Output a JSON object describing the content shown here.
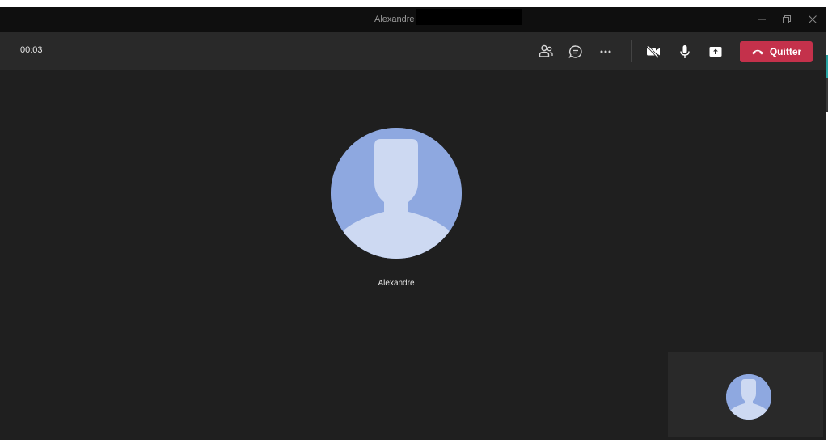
{
  "window": {
    "title": "Alexandre"
  },
  "toolbar": {
    "timer": "00:03",
    "leave_label": "Quitter",
    "buttons": [
      {
        "icon": "participants-icon"
      },
      {
        "icon": "chat-icon"
      },
      {
        "icon": "more-options-icon"
      },
      {
        "icon": "camera-off-icon"
      },
      {
        "icon": "microphone-icon"
      },
      {
        "icon": "share-screen-icon"
      }
    ]
  },
  "stage": {
    "participant_name": "Alexandre"
  },
  "colors": {
    "leave": "#c4314b",
    "avatar_bg": "#8ea8e0",
    "avatar_fg": "#cdd9f2",
    "stage_bg": "#1f1f1f",
    "toolbar_bg": "#292929",
    "titlebar_bg": "#0f0f0f"
  }
}
